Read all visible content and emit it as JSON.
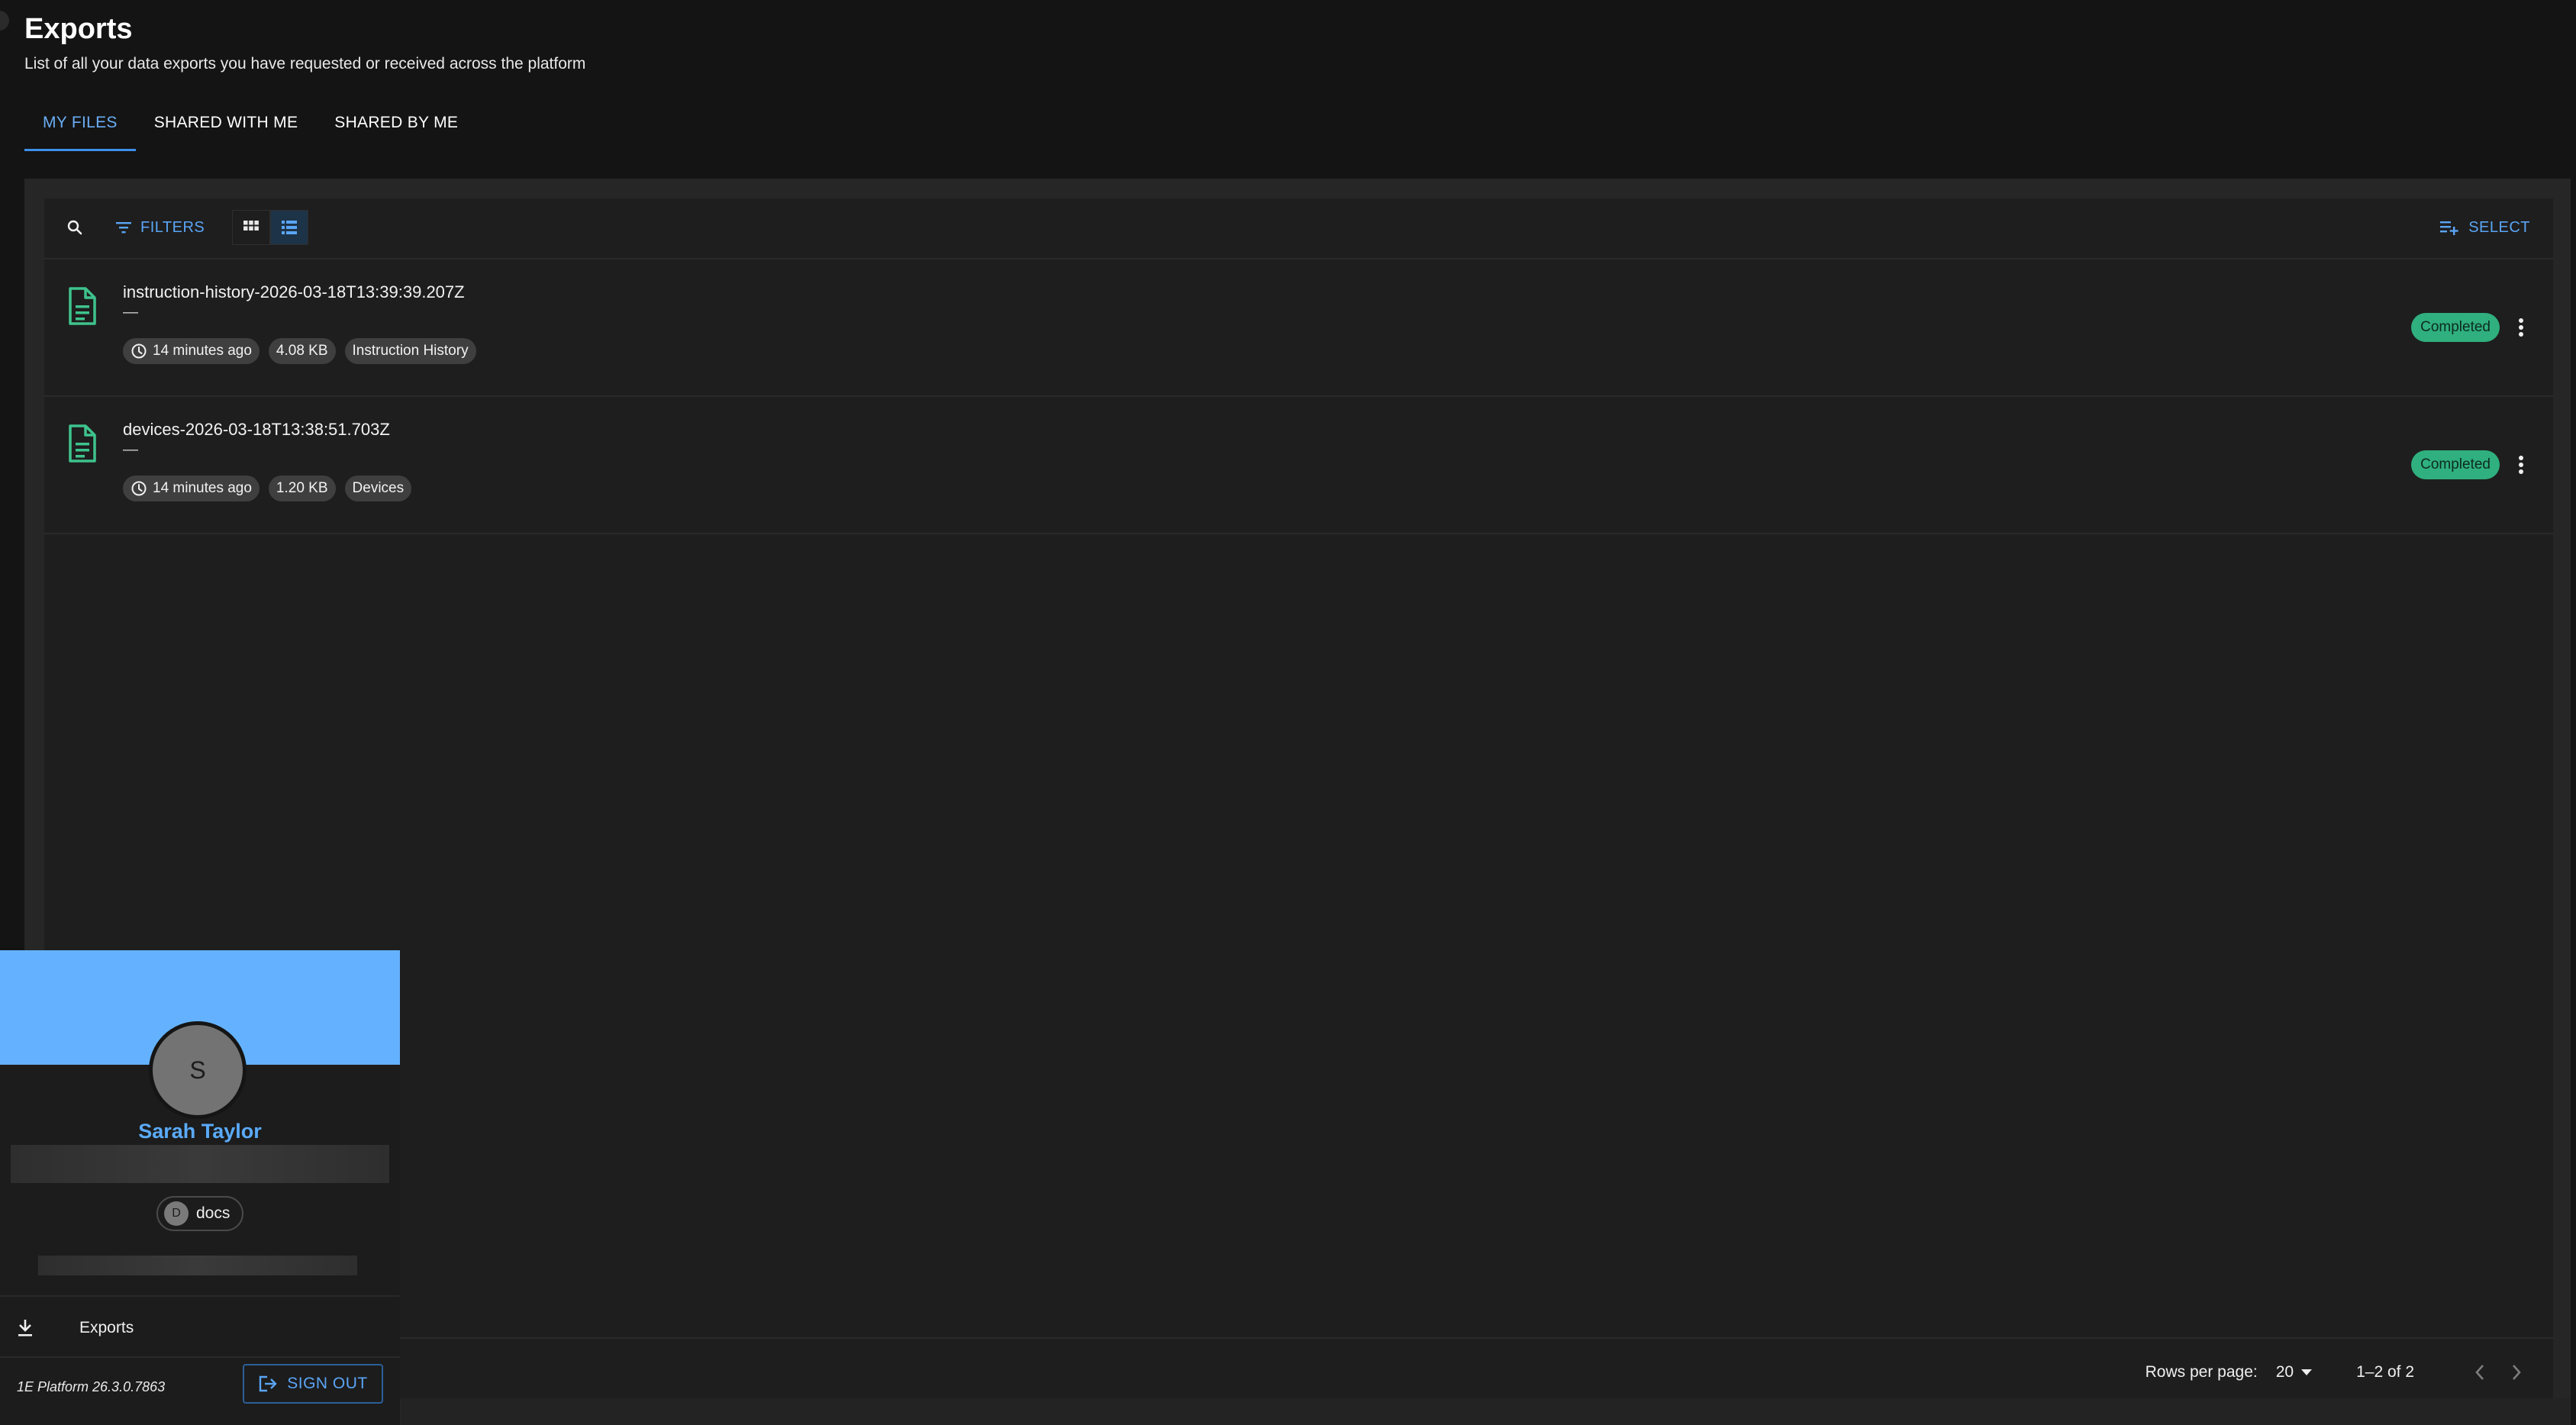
{
  "header": {
    "title": "Exports",
    "subtitle": "List of all your data exports you have requested or received across the platform"
  },
  "tabs": [
    {
      "label": "MY FILES",
      "active": true
    },
    {
      "label": "SHARED WITH ME",
      "active": false
    },
    {
      "label": "SHARED BY ME",
      "active": false
    }
  ],
  "toolbar": {
    "search_icon": "search-icon",
    "filters_label": "FILTERS",
    "view_modes": [
      "grid-view",
      "list-view"
    ],
    "active_view": "list-view",
    "select_label": "SELECT"
  },
  "files": [
    {
      "name": "instruction-history-2026-03-18T13:39:39.207Z",
      "description": "—",
      "age": "14 minutes ago",
      "size": "4.08 KB",
      "type": "Instruction History",
      "status": "Completed"
    },
    {
      "name": "devices-2026-03-18T13:38:51.703Z",
      "description": "—",
      "age": "14 minutes ago",
      "size": "1.20 KB",
      "type": "Devices",
      "status": "Completed"
    }
  ],
  "pagination": {
    "rows_per_page_label": "Rows per page:",
    "rows_per_page": "20",
    "range": "1–2 of 2"
  },
  "user_card": {
    "avatar_initial": "S",
    "name": "Sarah Taylor",
    "tenant_initial": "D",
    "tenant": "docs",
    "menu_item": "Exports",
    "version": "1E Platform 26.3.0.7863",
    "sign_out_label": "SIGN OUT"
  },
  "colors": {
    "accent": "#5aa5f5",
    "banner": "#64b2ff",
    "status_completed": "#2fb07e",
    "file_icon": "#3ec38d"
  }
}
